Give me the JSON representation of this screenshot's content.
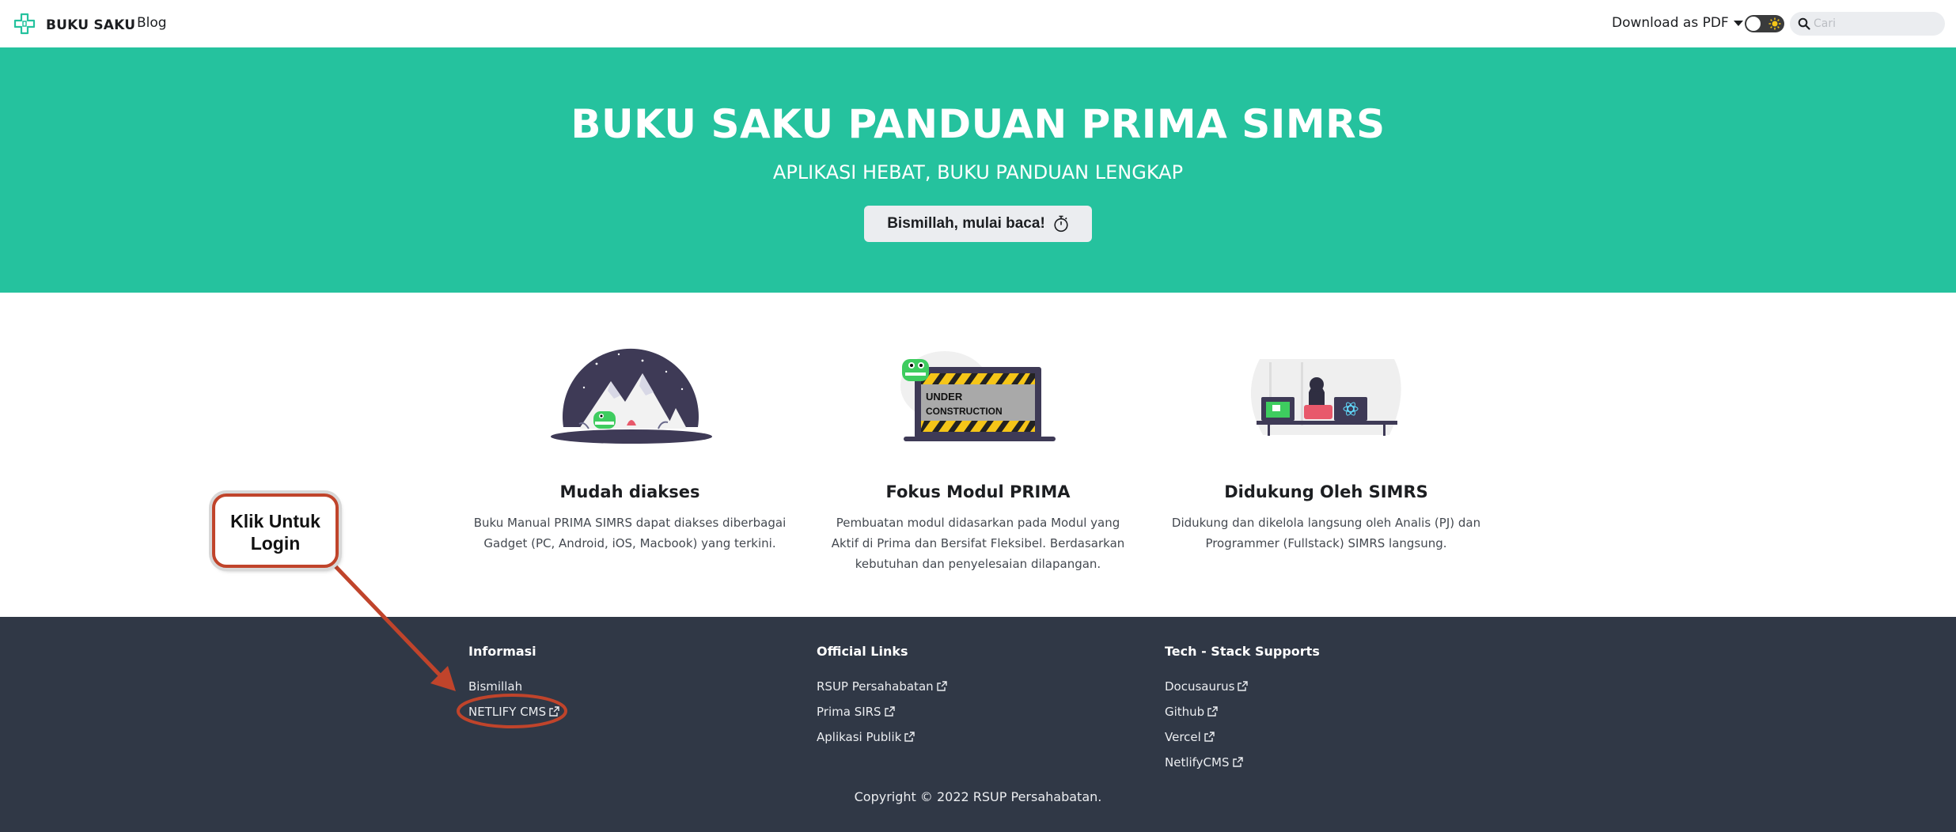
{
  "navbar": {
    "brand": "BUKU SAKU",
    "blog": "Blog",
    "download_pdf": "Download as PDF",
    "search_placeholder": "Cari"
  },
  "hero": {
    "title": "BUKU SAKU PANDUAN PRIMA SIMRS",
    "subtitle": "APLIKASI HEBAT, BUKU PANDUAN LENGKAP",
    "cta": "Bismillah, mulai baca!"
  },
  "features": [
    {
      "title": "Mudah diakses",
      "desc_line1": "Buku Manual PRIMA SIMRS dapat diakses diberbagai",
      "desc_line2": "Gadget (PC, Android, iOS, Macbook) yang terkini."
    },
    {
      "title": "Fokus Modul PRIMA",
      "desc_line1": "Pembuatan modul didasarkan pada Modul yang",
      "desc_line2": "Aktif di Prima dan Bersifat Fleksibel. Berdasarkan",
      "desc_line3": "kebutuhan dan penyelesaian dilapangan."
    },
    {
      "title": "Didukung Oleh SIMRS",
      "desc_line1": "Didukung dan dikelola langsung oleh Analis (PJ) dan",
      "desc_line2": "Programmer (Fullstack) SIMRS langsung."
    }
  ],
  "illustration_text": {
    "under": "UNDER",
    "construction": "CONSTRUCTION"
  },
  "annotation": {
    "line1": "Klik Untuk",
    "line2": "Login"
  },
  "footer": {
    "columns": [
      {
        "title": "Informasi",
        "links": [
          "Bismillah",
          "NETLIFY CMS"
        ]
      },
      {
        "title": "Official Links",
        "links": [
          "RSUP Persahabatan",
          "Prima SIRS",
          "Aplikasi Publik"
        ]
      },
      {
        "title": "Tech - Stack Supports",
        "links": [
          "Docusaurus",
          "Github",
          "Vercel",
          "NetlifyCMS"
        ]
      }
    ],
    "copyright": "Copyright © 2022 RSUP Persahabatan."
  },
  "colors": {
    "hero_bg": "#25c29e",
    "footer_bg": "#303846",
    "annotation": "#c0442b"
  }
}
